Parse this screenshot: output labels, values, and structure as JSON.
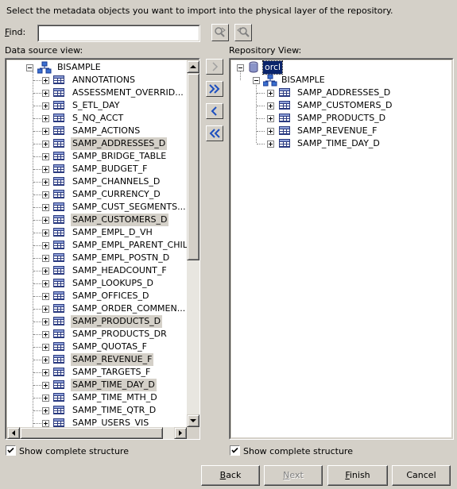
{
  "instruction": "Select the metadata objects you want to import into the physical layer of the repository.",
  "find": {
    "label_u": "F",
    "label_rest": "ind:",
    "value": ""
  },
  "datasource": {
    "label": "Data source view:",
    "root": "BISAMPLE",
    "items": [
      {
        "label": "ANNOTATIONS",
        "selected": false
      },
      {
        "label": "ASSESSMENT_OVERRID...",
        "selected": false
      },
      {
        "label": "S_ETL_DAY",
        "selected": false
      },
      {
        "label": "S_NQ_ACCT",
        "selected": false
      },
      {
        "label": "SAMP_ACTIONS",
        "selected": false
      },
      {
        "label": "SAMP_ADDRESSES_D",
        "selected": true
      },
      {
        "label": "SAMP_BRIDGE_TABLE",
        "selected": false
      },
      {
        "label": "SAMP_BUDGET_F",
        "selected": false
      },
      {
        "label": "SAMP_CHANNELS_D",
        "selected": false
      },
      {
        "label": "SAMP_CURRENCY_D",
        "selected": false
      },
      {
        "label": "SAMP_CUST_SEGMENTS...",
        "selected": false
      },
      {
        "label": "SAMP_CUSTOMERS_D",
        "selected": true
      },
      {
        "label": "SAMP_EMPL_D_VH",
        "selected": false
      },
      {
        "label": "SAMP_EMPL_PARENT_CHIL",
        "selected": false
      },
      {
        "label": "SAMP_EMPL_POSTN_D",
        "selected": false
      },
      {
        "label": "SAMP_HEADCOUNT_F",
        "selected": false
      },
      {
        "label": "SAMP_LOOKUPS_D",
        "selected": false
      },
      {
        "label": "SAMP_OFFICES_D",
        "selected": false
      },
      {
        "label": "SAMP_ORDER_COMMEN...",
        "selected": false
      },
      {
        "label": "SAMP_PRODUCTS_D",
        "selected": true
      },
      {
        "label": "SAMP_PRODUCTS_DR",
        "selected": false
      },
      {
        "label": "SAMP_QUOTAS_F",
        "selected": false
      },
      {
        "label": "SAMP_REVENUE_F",
        "selected": true
      },
      {
        "label": "SAMP_TARGETS_F",
        "selected": false
      },
      {
        "label": "SAMP_TIME_DAY_D",
        "selected": true
      },
      {
        "label": "SAMP_TIME_MTH_D",
        "selected": false
      },
      {
        "label": "SAMP_TIME_QTR_D",
        "selected": false
      },
      {
        "label": "SAMP_USERS_VIS",
        "selected": false
      }
    ],
    "show_complete": "Show complete structure",
    "show_checked": true
  },
  "repository": {
    "label": "Repository View:",
    "root": "orcl",
    "schema": "BISAMPLE",
    "items": [
      {
        "label": "SAMP_ADDRESSES_D"
      },
      {
        "label": "SAMP_CUSTOMERS_D"
      },
      {
        "label": "SAMP_PRODUCTS_D"
      },
      {
        "label": "SAMP_REVENUE_F"
      },
      {
        "label": "SAMP_TIME_DAY_D"
      }
    ],
    "show_complete": "Show complete structure",
    "show_checked": true
  },
  "transfer": {
    "add": "add-icon",
    "add_all": "add-all-icon",
    "remove": "remove-icon",
    "remove_all": "remove-all-icon"
  },
  "footer": {
    "back_u": "B",
    "back_rest": "ack",
    "next_u": "N",
    "next_rest": "ext",
    "finish_u": "F",
    "finish_rest": "inish",
    "cancel": "Cancel"
  }
}
